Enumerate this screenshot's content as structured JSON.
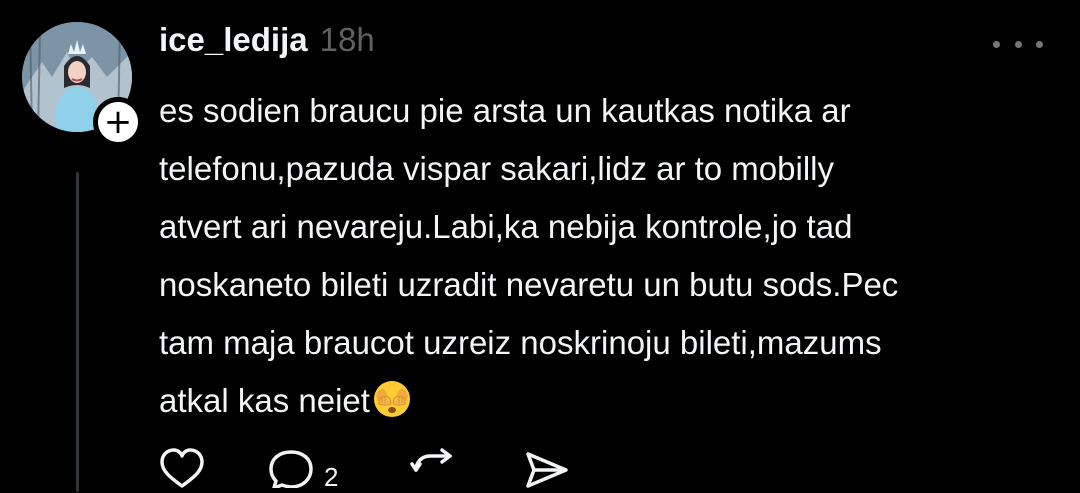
{
  "post": {
    "author": {
      "username": "ice_ledija",
      "avatar": "avatar-ice-queen-photo"
    },
    "timestamp": "18h",
    "text_lines": [
      "es sodien braucu pie arsta un kautkas notika ar",
      "telefonu,pazuda vispar sakari,lidz ar to mobilly",
      "atvert ari nevareju.Labi,ka nebija kontrole,jo tad",
      "noskaneto bileti uzradit nevaretu un butu sods.Pec",
      "tam maja braucot uzreiz noskrinoju bileti,mazums",
      "atkal kas neiet"
    ],
    "trailing_emoji": "see-no-evil-face-emoji",
    "actions": {
      "like_icon": "heart-icon",
      "reply_icon": "comment-icon",
      "reply_count": "2",
      "repost_icon": "repost-icon",
      "share_icon": "send-icon"
    },
    "more_icon": "more-options-icon"
  },
  "colors": {
    "background": "#000000",
    "text_primary": "#f3f5f7",
    "text_secondary": "#616161",
    "thread_line": "#333638"
  }
}
